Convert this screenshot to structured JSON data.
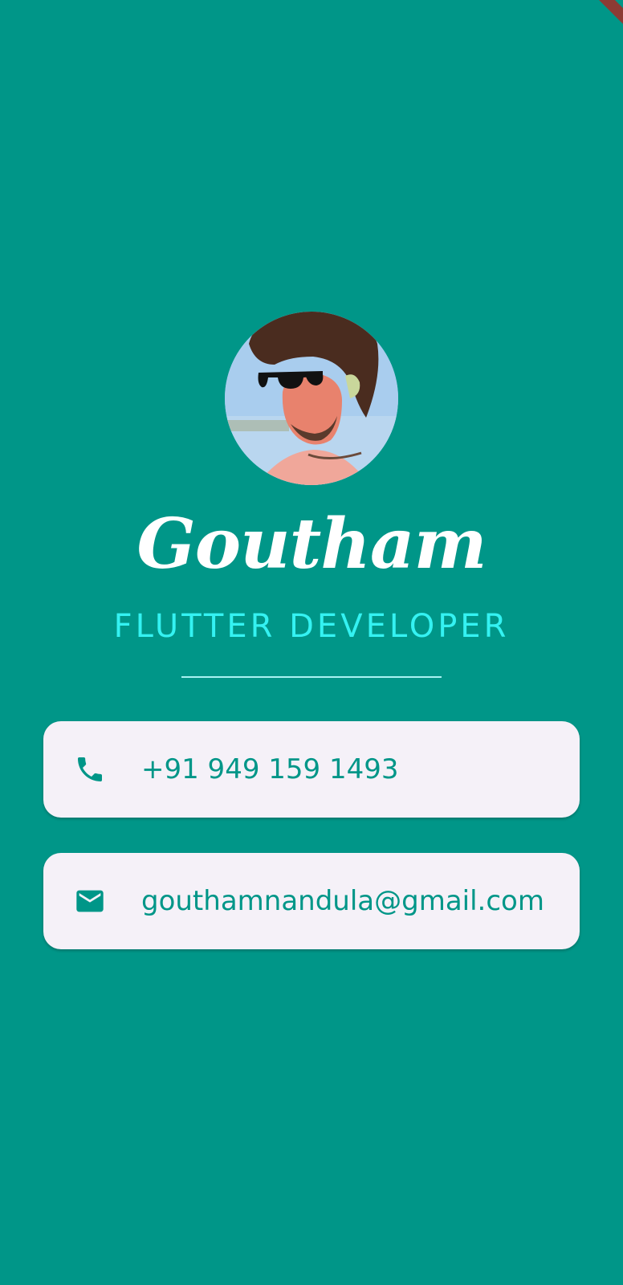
{
  "profile": {
    "name": "Goutham",
    "title": "FLUTTER DEVELOPER"
  },
  "contacts": {
    "phone": {
      "icon": "phone-icon",
      "value": "+91 949 159 1493"
    },
    "email": {
      "icon": "mail-icon",
      "value": "gouthamnandula@gmail.com"
    }
  },
  "colors": {
    "background": "#009688",
    "accent": "#34f2f2",
    "card": "#f5f1f8",
    "card_text": "#009688"
  }
}
